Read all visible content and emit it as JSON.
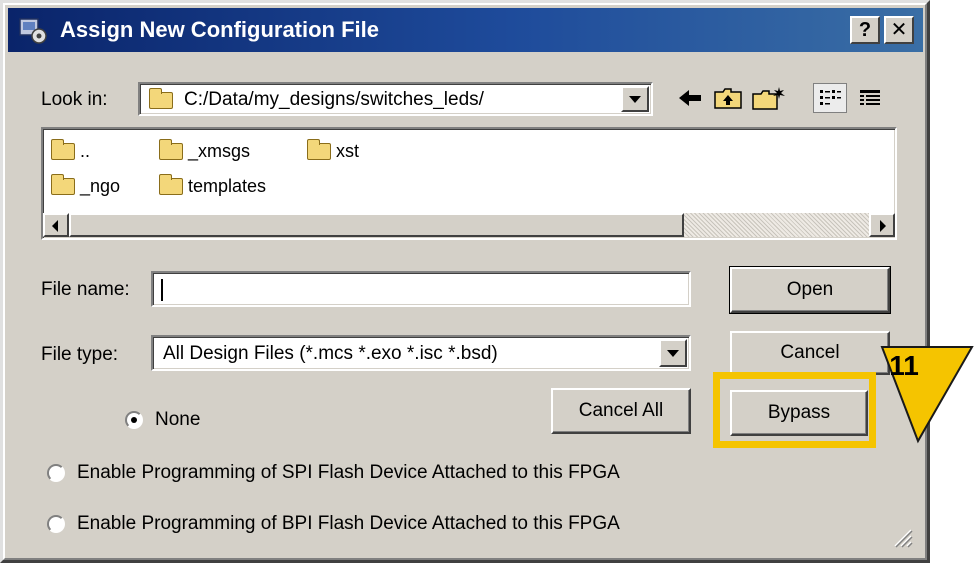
{
  "dialog": {
    "title": "Assign New Configuration File",
    "help_button": "?",
    "close_button": "✕"
  },
  "look_in": {
    "label": "Look in:",
    "path": "C:/Data/my_designs/switches_leds/"
  },
  "toolbar_icons": [
    "back-arrow-icon",
    "up-folder-icon",
    "new-folder-icon",
    "list-view-icon",
    "details-view-icon"
  ],
  "files": [
    {
      "name": ".."
    },
    {
      "name": "_xmsgs"
    },
    {
      "name": "xst"
    },
    {
      "name": "_ngo"
    },
    {
      "name": "templates"
    }
  ],
  "file_name": {
    "label": "File name:",
    "value": ""
  },
  "file_type": {
    "label": "File type:",
    "value": "All Design Files (*.mcs *.exo *.isc *.bsd)"
  },
  "buttons": {
    "open": "Open",
    "cancel": "Cancel",
    "cancel_all": "Cancel All",
    "bypass": "Bypass"
  },
  "options": [
    {
      "label": "None",
      "checked": true
    },
    {
      "label": "Enable Programming of SPI Flash Device Attached to this FPGA",
      "checked": false
    },
    {
      "label": "Enable Programming of BPI Flash Device Attached to this FPGA",
      "checked": false
    }
  ],
  "callout": {
    "number": "11",
    "color": "#f5c400"
  }
}
